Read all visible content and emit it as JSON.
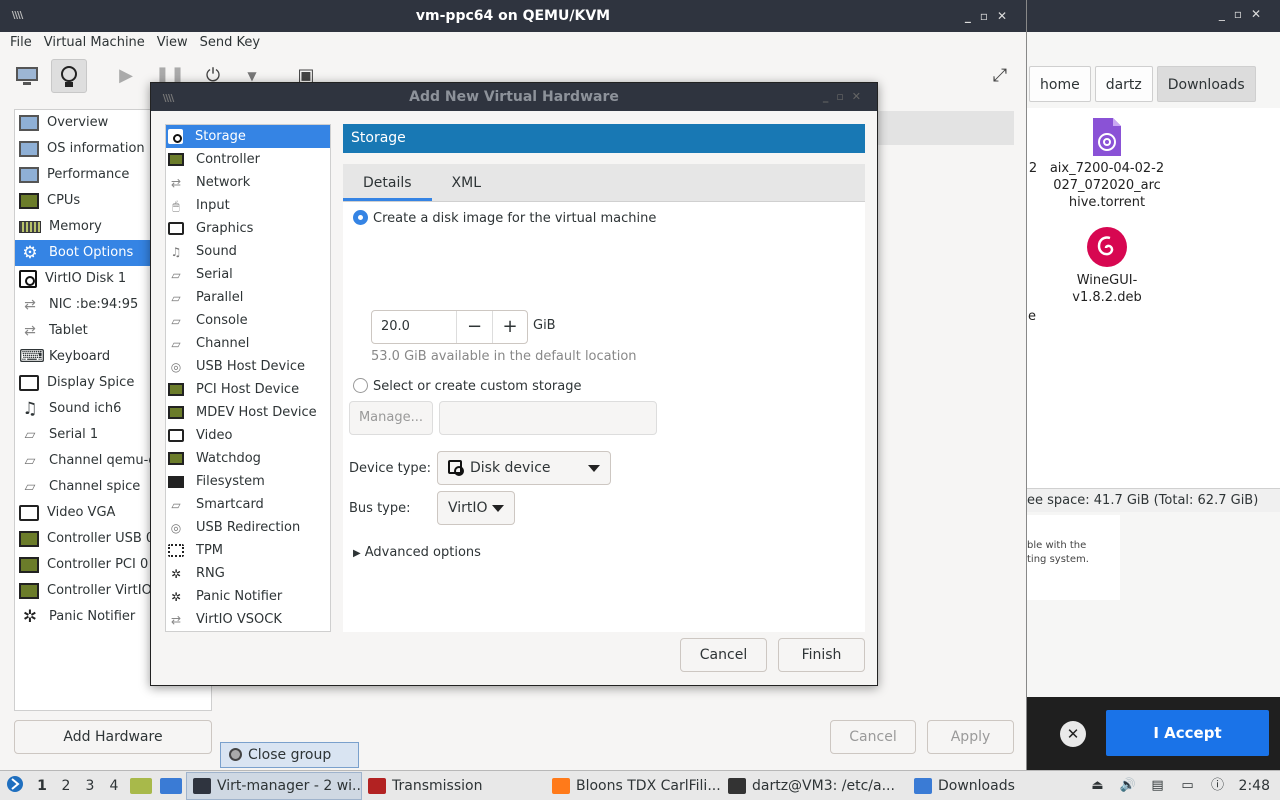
{
  "colors": {
    "accent": "#3584e4",
    "header_blue": "#1878b4",
    "titlebar": "#2f343f",
    "accept_blue": "#1a73e8"
  },
  "file_manager": {
    "breadcrumbs": [
      "home",
      "dartz",
      "Downloads"
    ],
    "files": [
      {
        "icon": "torrent-file-icon",
        "name": "aix_7200-04-02-2\n027_072020_arc\nhive.torrent"
      },
      {
        "icon": "debian-package-icon",
        "name": "WineGUI-\nv1.8.2.deb"
      }
    ],
    "left_fragment": "2",
    "edge_fragment": "e",
    "status": "ee space: 41.7 GiB (Total: 62.7 GiB)",
    "notice_line1": "ble with the",
    "notice_line2": "ting system."
  },
  "cookie": {
    "close": "✕",
    "accept": "I Accept"
  },
  "vm_window": {
    "title": "vm-ppc64 on QEMU/KVM",
    "menu": [
      "File",
      "Virtual Machine",
      "View",
      "Send Key"
    ],
    "sidebar": [
      {
        "icon": "monitor-icon",
        "label": "Overview"
      },
      {
        "icon": "info-monitor-icon",
        "label": "OS information"
      },
      {
        "icon": "performance-icon",
        "label": "Performance"
      },
      {
        "icon": "cpu-icon",
        "label": "CPUs"
      },
      {
        "icon": "memory-icon",
        "label": "Memory"
      },
      {
        "icon": "gear-icon",
        "label": "Boot Options",
        "selected": true
      },
      {
        "icon": "disk-icon",
        "label": "VirtIO Disk 1"
      },
      {
        "icon": "network-icon",
        "label": "NIC :be:94:95"
      },
      {
        "icon": "tablet-icon",
        "label": "Tablet"
      },
      {
        "icon": "keyboard-icon",
        "label": "Keyboard"
      },
      {
        "icon": "display-icon",
        "label": "Display Spice"
      },
      {
        "icon": "sound-icon",
        "label": "Sound ich6"
      },
      {
        "icon": "serial-icon",
        "label": "Serial 1"
      },
      {
        "icon": "channel-icon",
        "label": "Channel qemu-g"
      },
      {
        "icon": "channel-icon",
        "label": "Channel spice"
      },
      {
        "icon": "video-icon",
        "label": "Video VGA"
      },
      {
        "icon": "controller-icon",
        "label": "Controller USB 0"
      },
      {
        "icon": "controller-icon",
        "label": "Controller PCI 0"
      },
      {
        "icon": "controller-icon",
        "label": "Controller VirtIO"
      },
      {
        "icon": "panic-icon",
        "label": "Panic Notifier"
      }
    ],
    "add_hardware": "Add Hardware",
    "cancel": "Cancel",
    "apply": "Apply",
    "close_group": "Close group"
  },
  "dialog": {
    "title": "Add New Virtual Hardware",
    "hardware": [
      {
        "icon": "storage-icon",
        "label": "Storage",
        "selected": true
      },
      {
        "icon": "controller-icon",
        "label": "Controller"
      },
      {
        "icon": "network-icon",
        "label": "Network"
      },
      {
        "icon": "mouse-icon",
        "label": "Input"
      },
      {
        "icon": "graphics-icon",
        "label": "Graphics"
      },
      {
        "icon": "sound-icon",
        "label": "Sound"
      },
      {
        "icon": "serial-icon",
        "label": "Serial"
      },
      {
        "icon": "parallel-icon",
        "label": "Parallel"
      },
      {
        "icon": "console-icon",
        "label": "Console"
      },
      {
        "icon": "channel-icon",
        "label": "Channel"
      },
      {
        "icon": "usb-icon",
        "label": "USB Host Device"
      },
      {
        "icon": "pci-icon",
        "label": "PCI Host Device"
      },
      {
        "icon": "mdev-icon",
        "label": "MDEV Host Device"
      },
      {
        "icon": "video-icon",
        "label": "Video"
      },
      {
        "icon": "watchdog-icon",
        "label": "Watchdog"
      },
      {
        "icon": "folder-icon",
        "label": "Filesystem"
      },
      {
        "icon": "smartcard-icon",
        "label": "Smartcard"
      },
      {
        "icon": "usb-redirection-icon",
        "label": "USB Redirection"
      },
      {
        "icon": "tpm-icon",
        "label": "TPM"
      },
      {
        "icon": "rng-icon",
        "label": "RNG"
      },
      {
        "icon": "panic-icon",
        "label": "Panic Notifier"
      },
      {
        "icon": "vsock-icon",
        "label": "VirtIO VSOCK"
      }
    ],
    "header": "Storage",
    "tabs": [
      "Details",
      "XML"
    ],
    "create_disk_label": "Create a disk image for the virtual machine",
    "size_value": "20.0",
    "size_unit": "GiB",
    "minus": "−",
    "plus": "+",
    "available": "53.0 GiB available in the default location",
    "custom_storage_label": "Select or create custom storage",
    "manage": "Manage...",
    "device_type_label": "Device type:",
    "device_type_value": "Disk device",
    "bus_type_label": "Bus type:",
    "bus_type_value": "VirtIO",
    "advanced": "Advanced options",
    "cancel": "Cancel",
    "finish": "Finish"
  },
  "taskbar": {
    "workspaces": [
      "1",
      "2",
      "3",
      "4"
    ],
    "tasks": [
      {
        "label": "Virt-manager - 2 wi...",
        "active": true,
        "color": "#2f343f"
      },
      {
        "label": "Transmission",
        "active": false,
        "color": "#b22222"
      },
      {
        "label": "Bloons TDX CarlFili...",
        "active": false,
        "color": "#ff7a1a"
      },
      {
        "label": "dartz@VM3: /etc/a...",
        "active": false,
        "color": "#333333"
      },
      {
        "label": "Downloads",
        "active": false,
        "color": "#3a7bd5"
      }
    ],
    "clock": "2:48"
  }
}
